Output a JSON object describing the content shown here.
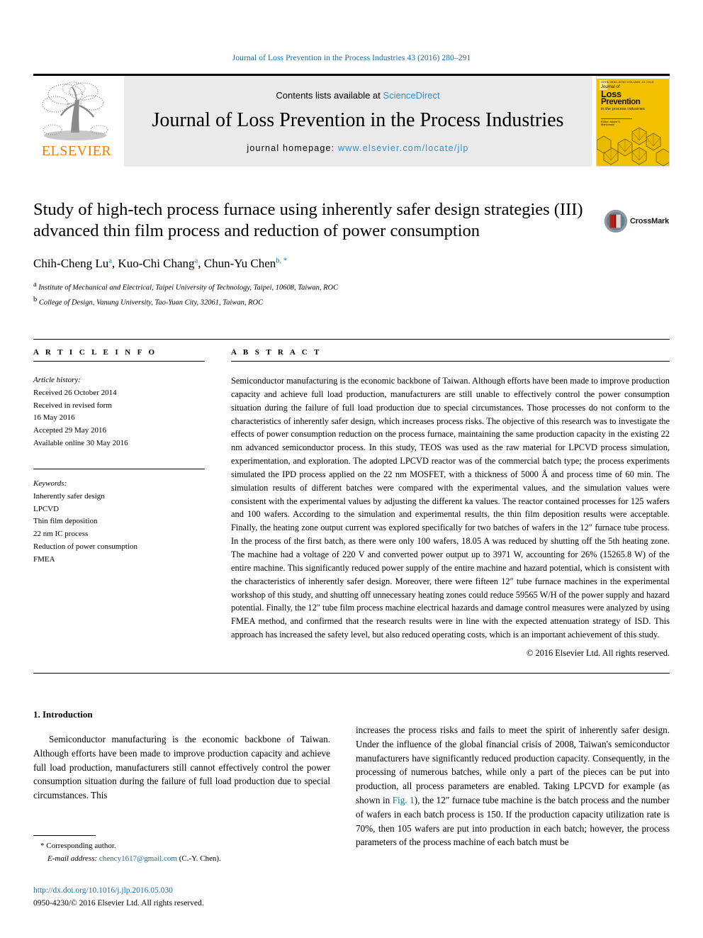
{
  "running_head": "Journal of Loss Prevention in the Process Industries 43 (2016) 280–291",
  "masthead": {
    "publisher_name": "ELSEVIER",
    "contents_prefix": "Contents lists available at ",
    "contents_link": "ScienceDirect",
    "journal_title": "Journal of Loss Prevention in the Process Industries",
    "homepage_prefix": "journal homepage: ",
    "homepage_url": "www.elsevier.com/locate/jlp",
    "cover": {
      "top_tiny": "ISSN 0950-4230   VOLUME 43   2016",
      "line_journal": "Journal of",
      "line_loss": "Loss",
      "line_prevention": "Prevention",
      "line_sub": "in the process industries",
      "line_editor": "Editor: Adam S. Markowski"
    }
  },
  "article": {
    "title": "Study of high-tech process furnace using inherently safer design strategies (III) advanced thin film process and reduction of power consumption",
    "authors": [
      {
        "name": "Chih-Cheng Lu",
        "sup": "a"
      },
      {
        "name": "Kuo-Chi Chang",
        "sup": "a"
      },
      {
        "name": "Chun-Yu Chen",
        "sup": "b, *"
      }
    ],
    "affiliations": [
      {
        "marker": "a",
        "text": "Institute of Mechanical and Electrical, Taipei University of Technology, Taipei, 10608, Taiwan, ROC"
      },
      {
        "marker": "b",
        "text": "College of Design, Vanung University, Tao-Yuan City, 32061, Taiwan, ROC"
      }
    ],
    "crossmark_label": "CrossMark"
  },
  "article_info": {
    "heading": "A R T I C L E   I N F O",
    "history_label": "Article history:",
    "history": [
      "Received 26 October 2014",
      "Received in revised form",
      "16 May 2016",
      "Accepted 29 May 2016",
      "Available online 30 May 2016"
    ],
    "keywords_label": "Keywords:",
    "keywords": [
      "Inherently safer design",
      "LPCVD",
      "Thin film deposition",
      "22 nm IC process",
      "Reduction of power consumption",
      "FMEA"
    ]
  },
  "abstract": {
    "heading": "A B S T R A C T",
    "text": "Semiconductor manufacturing is the economic backbone of Taiwan. Although efforts have been made to improve production capacity and achieve full load production, manufacturers are still unable to effectively control the power consumption situation during the failure of full load production due to special circumstances. Those processes do not conform to the characteristics of inherently safer design, which increases process risks. The objective of this research was to investigate the effects of power consumption reduction on the process furnace, maintaining the same production capacity in the existing 22 nm advanced semiconductor process. In this study, TEOS was used as the raw material for LPCVD process simulation, experimentation, and exploration. The adopted LPCVD reactor was of the commercial batch type; the process experiments simulated the IPD process applied on the 22 nm MOSFET, with a thickness of 5000 Å and process time of 60 min. The simulation results of different batches were compared with the experimental values, and the simulation values were consistent with the experimental values by adjusting the different ka values. The reactor contained processes for 125 wafers and 100 wafers. According to the simulation and experimental results, the thin film deposition results were acceptable. Finally, the heating zone output current was explored specifically for two batches of wafers in the 12″ furnace tube process. In the process of the first batch, as there were only 100 wafers, 18.05 A was reduced by shutting off the 5th heating zone. The machine had a voltage of 220 V and converted power output up to 3971 W, accounting for 26% (15265.8 W) of the entire machine. This significantly reduced power supply of the entire machine and hazard potential, which is consistent with the characteristics of inherently safer design. Moreover, there were fifteen 12″ tube furnace machines in the experimental workshop of this study, and shutting off unnecessary heating zones could reduce 59565 W/H of the power supply and hazard potential. Finally, the 12″ tube film process machine electrical hazards and damage control measures were analyzed by using FMEA method, and confirmed that the research results were in line with the expected attenuation strategy of ISD. This approach has increased the safety level, but also reduced operating costs, which is an important achievement of this study.",
    "copyright": "© 2016 Elsevier Ltd. All rights reserved."
  },
  "body": {
    "section_number_title": "1. Introduction",
    "left_paragraph": "Semiconductor manufacturing is the economic backbone of Taiwan. Although efforts have been made to improve production capacity and achieve full load production, manufacturers still cannot effectively control the power consumption situation during the failure of full load production due to special circumstances. This",
    "right_paragraph_part1": "increases the process risks and fails to meet the spirit of inherently safer design. Under the influence of the global financial crisis of 2008, Taiwan's semiconductor manufacturers have significantly reduced production capacity. Consequently, in the processing of numerous batches, while only a part of the pieces can be put into production, all process parameters are enabled. Taking LPCVD for example (as shown in ",
    "right_figure_link": "Fig. 1",
    "right_paragraph_part2": "), the 12″ furnace tube machine is the batch process and the number of wafers in each batch process is 150. If the production capacity utilization rate is 70%, then 105 wafers are put into production in each batch; however, the process parameters of the process machine of each batch must be"
  },
  "footnotes": {
    "corresponding_marker": "*",
    "corresponding_text": "Corresponding author.",
    "email_label": "E-mail address:",
    "email": "chency1617@gmail.com",
    "email_owner": "(C.-Y. Chen)."
  },
  "footer": {
    "doi": "http://dx.doi.org/10.1016/j.jlp.2016.05.030",
    "issn_line": "0950-4230/© 2016 Elsevier Ltd. All rights reserved."
  },
  "colors": {
    "link_blue": "#1a6ca8",
    "sciencedirect_blue": "#3a8cc8",
    "elsevier_orange": "#ef7e10",
    "cover_yellow": "#f2c200"
  }
}
